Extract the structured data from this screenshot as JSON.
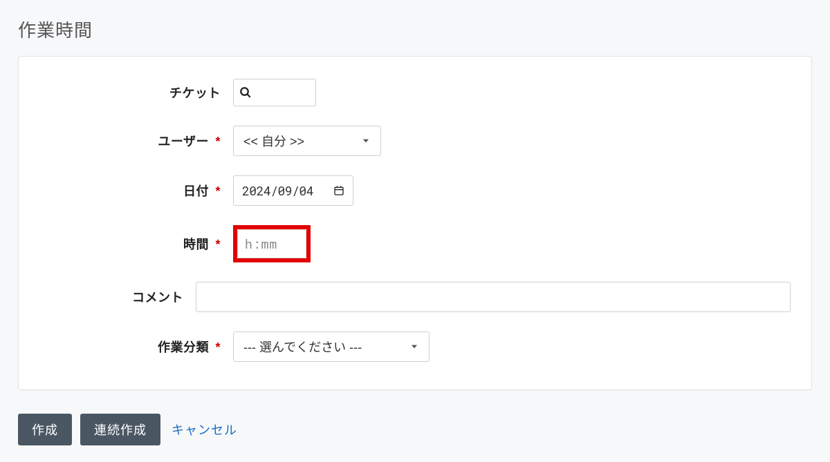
{
  "page": {
    "title": "作業時間"
  },
  "form": {
    "ticket": {
      "label": "チケット"
    },
    "user": {
      "label": "ユーザー",
      "value": "<< 自分 >>"
    },
    "date": {
      "label": "日付",
      "value": "2024/09/04"
    },
    "time": {
      "label": "時間",
      "placeholder": "h:mm"
    },
    "comment": {
      "label": "コメント"
    },
    "activity": {
      "label": "作業分類",
      "placeholder": "--- 選んでください ---"
    }
  },
  "actions": {
    "create": "作成",
    "create_continue": "連続作成",
    "cancel": "キャンセル"
  }
}
